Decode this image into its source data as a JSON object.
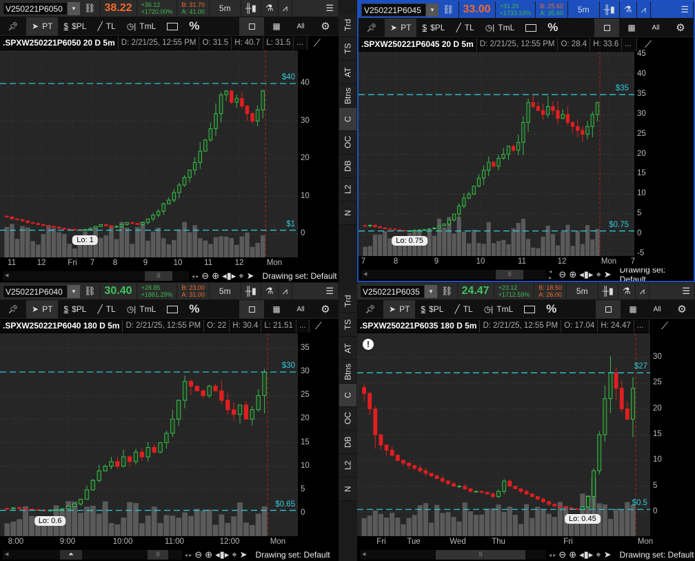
{
  "colors": {
    "up": "#3dbb4c",
    "down": "#e01f1f",
    "priceline": "#2ec6d2",
    "orange": "#f26b2b",
    "green": "#3ec45a",
    "active": "#1d4fbd"
  },
  "toolbar": {
    "pin": "pin-icon",
    "pt": "PT",
    "pl": "$PL",
    "tl": "TL",
    "tml": "TmL",
    "pct": "%",
    "all": "All"
  },
  "bottom": {
    "drawing_set": "Drawing set: Default"
  },
  "sidebar": {
    "tabs": [
      "Trd",
      "TS",
      "AT",
      "Btns",
      "C",
      "OC",
      "DB",
      "L2",
      "N"
    ],
    "selected": "C"
  },
  "panes": [
    {
      "symbol": "V250221P6050",
      "last": "38.22",
      "last_color": "#f26b2b",
      "change": "+36.12",
      "change_pct": "+1720.00%",
      "bid": "B: 31.70",
      "ask": "A: 41.00",
      "bid_color": "#f26b2b",
      "ask_color": "#3dbb4c",
      "interval": "5m",
      "title": ".SPXW250221P6050 20 D 5m",
      "date": "D: 2/21/25, 12:55 PM",
      "o": "O: 31.5",
      "h": "H: 40.7",
      "l": "L: 31.5",
      "more": "...",
      "y_ticks": [
        0,
        10,
        20,
        30,
        40
      ],
      "price_lines": [
        {
          "value": 40,
          "label": "$40"
        },
        {
          "value": 1,
          "label": "$1"
        }
      ],
      "lo_label": "Lo: 1",
      "x_labels": [
        "11",
        "12",
        "Fri",
        "7",
        "8",
        "9",
        "10",
        "11",
        "12",
        "Mon"
      ],
      "closes": [
        4.5,
        4,
        3.8,
        3.5,
        3,
        2.8,
        2.5,
        2.2,
        2,
        1.8,
        1.5,
        1.3,
        1.2,
        1.1,
        1,
        1.2,
        1.5,
        2,
        2.5,
        2.2,
        1.8,
        2,
        2.5,
        3,
        2.8,
        2.5,
        3,
        4,
        5,
        6,
        8,
        9,
        11,
        13,
        15,
        17,
        19,
        22,
        25,
        28,
        32,
        37,
        38,
        35,
        36,
        34,
        32,
        30,
        33,
        38
      ]
    },
    {
      "symbol": "V250221P6045",
      "last": "33.00",
      "last_color": "#f26b2b",
      "change": "+31.20",
      "change_pct": "+1733.33%",
      "bid": "B: 25.60",
      "ask": "A: 35.60",
      "bid_color": "#f26b2b",
      "ask_color": "#3dbb4c",
      "interval": "5m",
      "title": ".SPXW250221P6045 20 D 5m",
      "date": "D: 2/21/25, 12:55 PM",
      "o": "O: 28.4",
      "h": "H: 33.6",
      "l": "",
      "more": "...",
      "y_ticks": [
        -5,
        0,
        5,
        10,
        15,
        20,
        25,
        30,
        35,
        40,
        45
      ],
      "price_lines": [
        {
          "value": 35,
          "label": "$35"
        },
        {
          "value": 0.75,
          "label": "$0.75"
        }
      ],
      "lo_label": "Lo: 0.75",
      "x_labels": [
        "7",
        "8",
        "9",
        "10",
        "11",
        "12",
        "Mon",
        "7"
      ],
      "closes": [
        2,
        2.2,
        1.8,
        1.5,
        1.3,
        1.2,
        1,
        0.9,
        0.8,
        0.8,
        0.9,
        1,
        1.1,
        1.3,
        1.5,
        2,
        2.5,
        3.5,
        5,
        7,
        9,
        10,
        12,
        14,
        16,
        18,
        17,
        19,
        20,
        22,
        21,
        23,
        28,
        33,
        32,
        31,
        30,
        32,
        31,
        29,
        30,
        28,
        27,
        26,
        25,
        27,
        30,
        33
      ]
    },
    {
      "symbol": "V250221P6040",
      "last": "30.40",
      "last_color": "#3ec45a",
      "change": "+28.85",
      "change_pct": "+1861.29%",
      "bid": "B: 23.00",
      "ask": "A: 31.00",
      "bid_color": "#f26b2b",
      "ask_color": "#f26b2b",
      "interval": "5m",
      "title": ".SPXW250221P6040 180 D 5m",
      "date": "D: 2/21/25, 12:55 PM",
      "o": "O: 22",
      "h": "H: 30.4",
      "l": "L: 21.51",
      "more": "...",
      "y_ticks": [
        0,
        5,
        10,
        15,
        20,
        25,
        30,
        35
      ],
      "price_lines": [
        {
          "value": 30,
          "label": "$30"
        },
        {
          "value": 0.65,
          "label": "$0.65"
        }
      ],
      "lo_label": "Lo: 0.6",
      "x_labels": [
        "8:00",
        "9:00",
        "10:00",
        "11:00",
        "12:00",
        "Mon"
      ],
      "closes": [
        1,
        1.2,
        1,
        0.9,
        0.8,
        0.7,
        0.6,
        0.7,
        0.8,
        1,
        1.5,
        2,
        3,
        5,
        7,
        9,
        10,
        11,
        10,
        12,
        11,
        13,
        12,
        14,
        13,
        15,
        17,
        20,
        24,
        28,
        27,
        26,
        25,
        27,
        26,
        24,
        22,
        21,
        23,
        20,
        22,
        25,
        30
      ]
    },
    {
      "symbol": "V250221P6035",
      "last": "24.47",
      "last_color": "#3ec45a",
      "change": "+23.12",
      "change_pct": "+1712.59%",
      "bid": "B: 18.50",
      "ask": "A: 26.00",
      "bid_color": "#f26b2b",
      "ask_color": "#f26b2b",
      "interval": "5m",
      "title": ".SPXW250221P6035 180 D 5m",
      "date": "D: 2/21/25, 12:55 PM",
      "o": "O: 17.04",
      "h": "H: 24.47",
      "l": "",
      "more": "...",
      "y_ticks": [
        0,
        5,
        10,
        15,
        20,
        25,
        30
      ],
      "price_lines": [
        {
          "value": 27,
          "label": "$27"
        },
        {
          "value": 0.5,
          "label": "$0.5"
        }
      ],
      "lo_label": "Lo: 0.45",
      "warning": "!",
      "x_labels": [
        "Fri",
        "Tue",
        "Wed",
        "Thu",
        "Fri",
        "Mon"
      ],
      "closes": [
        23,
        20,
        15,
        13,
        12,
        11,
        10,
        9.5,
        9,
        8.5,
        8,
        7.5,
        7,
        6.5,
        6,
        5.5,
        5,
        5,
        4.5,
        4,
        4,
        3.8,
        3.5,
        3,
        4,
        6,
        5,
        4.5,
        4,
        3.5,
        3,
        2.5,
        2,
        1.5,
        1.2,
        1,
        0.8,
        0.6,
        0.5,
        1,
        3,
        8,
        15,
        22,
        27,
        24,
        20,
        18,
        24
      ]
    }
  ]
}
